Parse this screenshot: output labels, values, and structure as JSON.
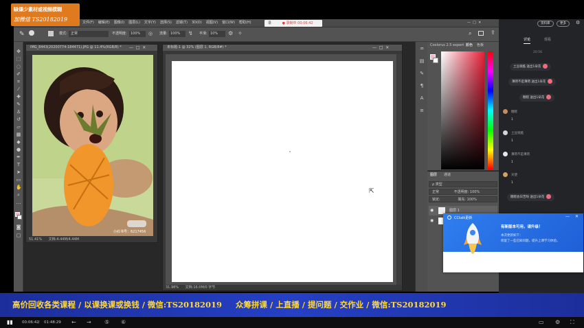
{
  "top_banner": {
    "line1": "缺课少素材或视频模糊",
    "line2": "加微信 TS20182019"
  },
  "recording_bar": {
    "icon_label": "录",
    "status": "● 录制中 00:06:42"
  },
  "menubar": {
    "items": [
      "文件(F)",
      "编辑(E)",
      "图像(I)",
      "图层(L)",
      "文字(Y)",
      "选择(S)",
      "滤镜(T)",
      "3D(D)",
      "视图(V)",
      "窗口(W)",
      "帮助(H)"
    ]
  },
  "options_bar": {
    "mode_label": "模式:",
    "mode_value": "正常",
    "opacity_label": "不透明度:",
    "opacity_value": "100%",
    "flow_label": "流量:",
    "flow_value": "100%",
    "smoothing_label": "平滑:",
    "smoothing_value": "10%"
  },
  "photo_doc": {
    "tab": "IMG_8443(20200774-184471).JPG @ 11.4%(RGB/8) *",
    "zoom": "51.41%",
    "doc_info": "文档:4.44M/4.44M",
    "watermark": "小红书号：6217456"
  },
  "canvas_doc": {
    "tab": "未标题-1 @ 32% (图层 1, RGB/8#) *",
    "zoom": "31.98%",
    "doc_info": "文档:16.0M/0 字节"
  },
  "color_panel": {
    "tabs": [
      "Coolorus 2.5 expert",
      "颜色",
      "色板"
    ]
  },
  "layers_panel": {
    "tabs": [
      "图层",
      "通道"
    ],
    "kind_label": "ρ 类型",
    "blend_mode": "正常",
    "opacity_label": "不透明度:",
    "opacity_value": "100%",
    "lock_label": "锁定:",
    "fill_label": "填充:",
    "fill_value": "100%",
    "layer_name": "图层 1"
  },
  "chat": {
    "header_buttons": [
      "资料库",
      "更多"
    ],
    "tabs": [
      "讨论",
      "观看"
    ],
    "timestamp": "20:56",
    "gift_messages": [
      "土豆很酷 送出1朵花",
      "薄荷不是薄荷 送出1朵花",
      "糖糕 送出1朵花"
    ],
    "messages": [
      {
        "name": "糖糕",
        "text": "1"
      },
      {
        "name": "土豆很酷",
        "text": "1"
      },
      {
        "name": "薄荷不是薄荷",
        "text": "1"
      },
      {
        "name": "天使",
        "text": "1"
      }
    ],
    "last_gift": "糖糕会日苦呀 送出1朵花"
  },
  "update_popup": {
    "title": "CCtalk更新",
    "heading": "有新版本可用，请升级！",
    "body_line1": "本次更新如下：",
    "body_line2": "修复了一些已知问题，提升上课学习体验。"
  },
  "bottom_banner": {
    "text": "高价回收各类课程 / 以课换课或换钱 / 微信:TS20182019     众筹拼课 / 上直播 / 提问题 / 交作业 / 微信:TS20182019"
  },
  "playbar": {
    "current": "00:06:42",
    "total": "01:48:29"
  },
  "colors": {
    "banner_orange": "#e07a1e",
    "banner_blue": "#2540c5",
    "banner_text": "#ffd83a",
    "chat_bg": "#232427",
    "flower": "#f36b78",
    "popup_blue": "#2a72e6"
  }
}
